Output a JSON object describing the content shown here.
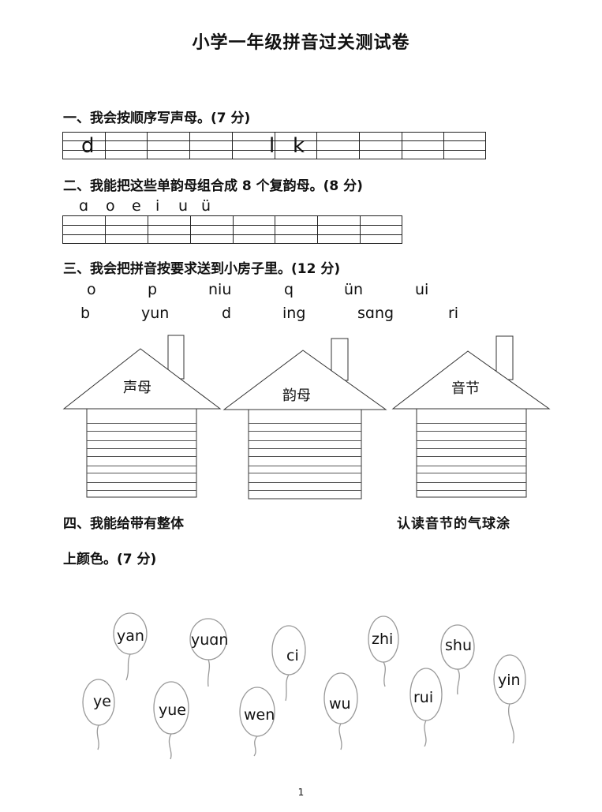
{
  "title": "小学一年级拼音过关测试卷",
  "q1": {
    "heading": "一、我会按顺序写声母。(7 分)",
    "cells": [
      "d",
      "",
      "",
      "l",
      "",
      "",
      "k",
      "",
      "",
      "",
      ""
    ]
  },
  "q2": {
    "heading": "二、我能把这些单韵母组合成 8 个复韵母。(8 分)",
    "vowels": [
      "ɑ",
      "o",
      "e",
      "i",
      "u",
      "ü"
    ]
  },
  "q3": {
    "heading": "三、我会把拼音按要求送到小房子里。(12 分)",
    "row1": [
      "o",
      "p",
      "niu",
      "q",
      "ün",
      "ui"
    ],
    "row2": [
      "b",
      "yun",
      "d",
      "ing",
      "sɑng",
      "ri"
    ],
    "houses": [
      "声母",
      "韵母",
      "音节"
    ]
  },
  "q4": {
    "heading_left": "四、我能给带有整体",
    "heading_right": "认读音节的气球涂",
    "heading_line2": "上颜色。(7 分)",
    "balloons": [
      "yan",
      "yuɑn",
      "ci",
      "zhi",
      "shu",
      "yin",
      "ye",
      "yue",
      "wen",
      "wu",
      "rui"
    ]
  },
  "page_number": "1"
}
